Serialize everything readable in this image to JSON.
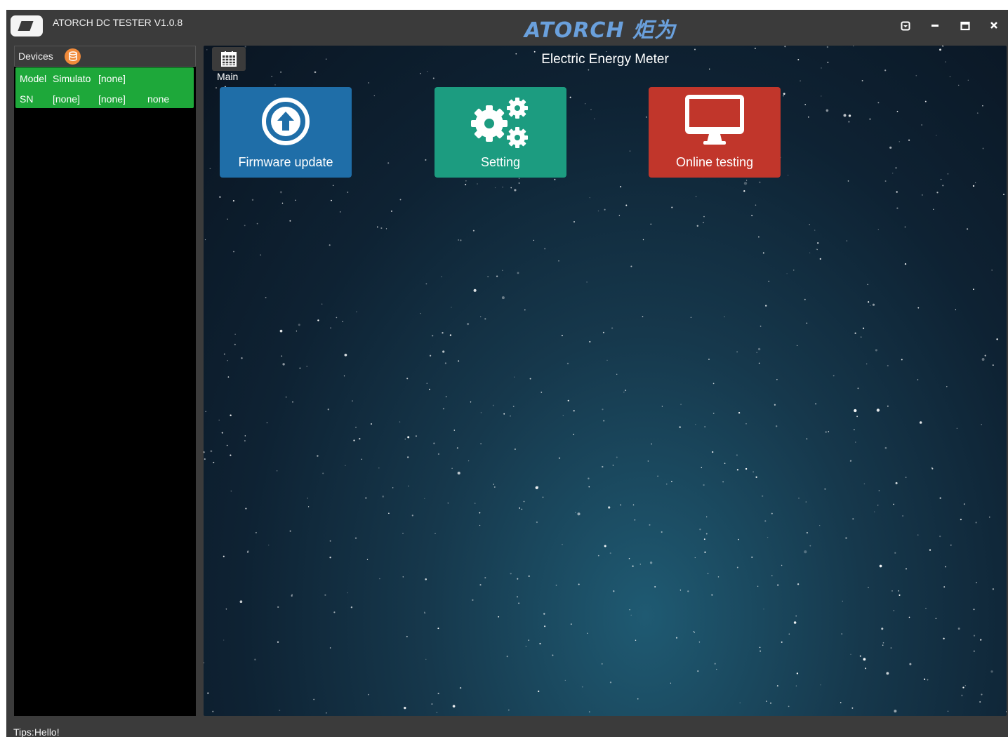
{
  "window": {
    "title": "ATORCH DC TESTER V1.0.8",
    "brand": "ATORCH 炬为"
  },
  "devices": {
    "label": "Devices",
    "items": [
      {
        "model_label": "Model",
        "model_value": "Simulato",
        "model_extra": "[none]",
        "sn_label": "SN",
        "sn_value": "[none]",
        "sn_extra": "[none]",
        "status": "none"
      }
    ]
  },
  "main": {
    "nav_label": "Main",
    "title": "Electric Energy Meter",
    "tiles": [
      {
        "label": "Firmware update",
        "icon": "upload-circle-icon",
        "color": "#1f6ea8"
      },
      {
        "label": "Setting",
        "icon": "gears-icon",
        "color": "#1c9c80"
      },
      {
        "label": "Online testing",
        "icon": "monitor-icon",
        "color": "#c1362b"
      }
    ]
  },
  "status_bar": {
    "tips": "Tips:Hello!"
  },
  "colors": {
    "titlebar": "#3b3b3b",
    "device_card": "#1ea83a",
    "brand": "#6aa0dc",
    "devices_icon": "#f08a3a"
  }
}
